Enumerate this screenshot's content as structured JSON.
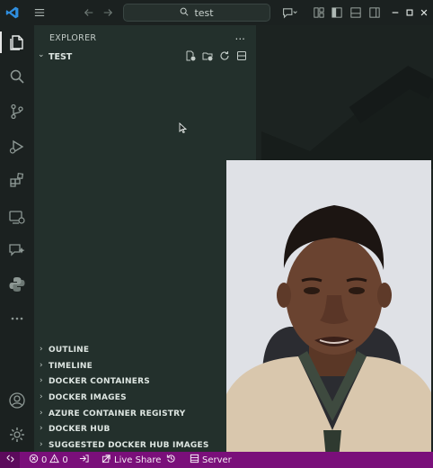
{
  "titlebar": {
    "search_text": "test"
  },
  "sidebar": {
    "title": "EXPLORER",
    "more": "...",
    "root_folder": "TEST",
    "sections": [
      "OUTLINE",
      "TIMELINE",
      "DOCKER CONTAINERS",
      "DOCKER IMAGES",
      "AZURE CONTAINER REGISTRY",
      "DOCKER HUB",
      "SUGGESTED DOCKER HUB IMAGES"
    ]
  },
  "statusbar": {
    "errors": "0",
    "warnings": "0",
    "live_share": "Live Share",
    "server": "Server"
  },
  "colors": {
    "status_bar": "#7a0f7a",
    "sidebar": "#23302c",
    "activity_bar": "#1b2120",
    "vscode_blue": "#2f8fe0"
  },
  "icons": {
    "activity": [
      "explorer-icon",
      "search-icon",
      "source-control-icon",
      "run-debug-icon",
      "extensions-icon",
      "remote-explorer-icon",
      "chat-icon",
      "python-icon",
      "more-icon",
      "account-icon",
      "manage-icon"
    ]
  }
}
